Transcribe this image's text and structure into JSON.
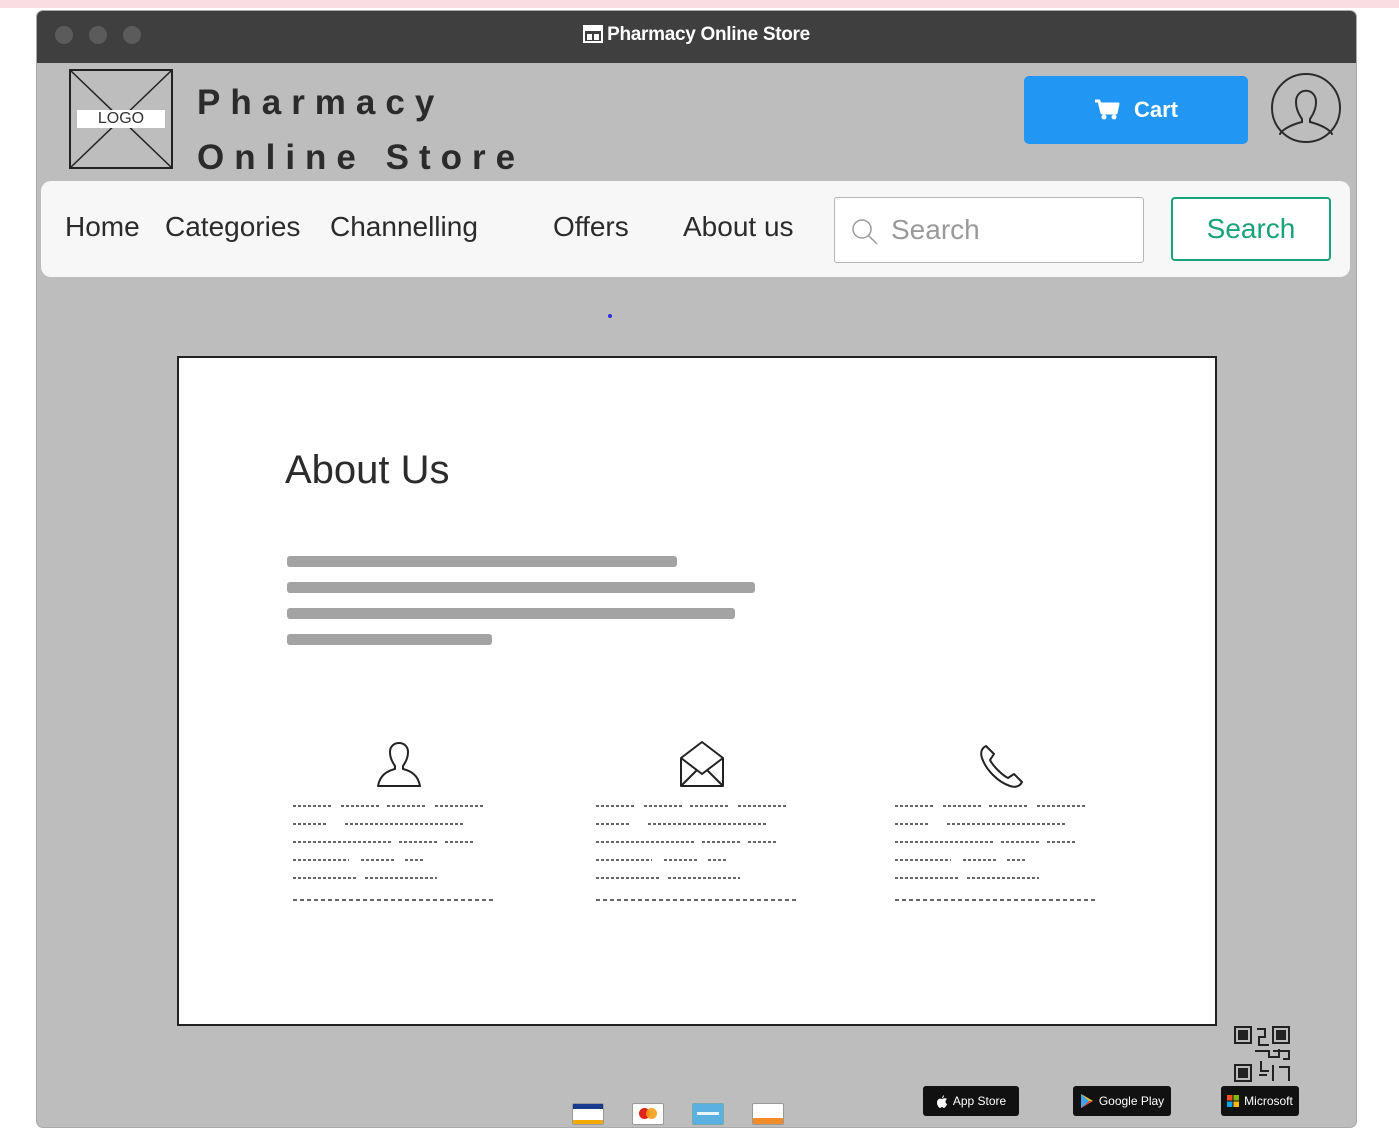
{
  "window": {
    "title": "Pharmacy Online Store"
  },
  "header": {
    "logo_label": "LOGO",
    "brand_line1": "Pharmacy",
    "brand_line2": "Online Store",
    "cart_label": "Cart"
  },
  "nav": {
    "items": [
      {
        "label": "Home"
      },
      {
        "label": "Categories"
      },
      {
        "label": "Channelling"
      },
      {
        "label": "Offers"
      },
      {
        "label": "About us"
      }
    ],
    "search_placeholder": "Search",
    "search_button": "Search"
  },
  "main": {
    "title": "About Us",
    "contact_columns": [
      {
        "icon": "person-icon"
      },
      {
        "icon": "envelope-icon"
      },
      {
        "icon": "phone-icon"
      }
    ]
  },
  "footer": {
    "payment_methods": [
      "visa-icon",
      "mastercard-icon",
      "amex-icon",
      "discover-icon"
    ],
    "store_badges": [
      {
        "label": "App Store"
      },
      {
        "label": "Google Play"
      },
      {
        "label": "Microsoft"
      }
    ]
  },
  "colors": {
    "accent_blue": "#2196f3",
    "accent_green": "#1aa37a",
    "window_bg": "#bdbdbd",
    "titlebar_bg": "#3f3f3f"
  }
}
